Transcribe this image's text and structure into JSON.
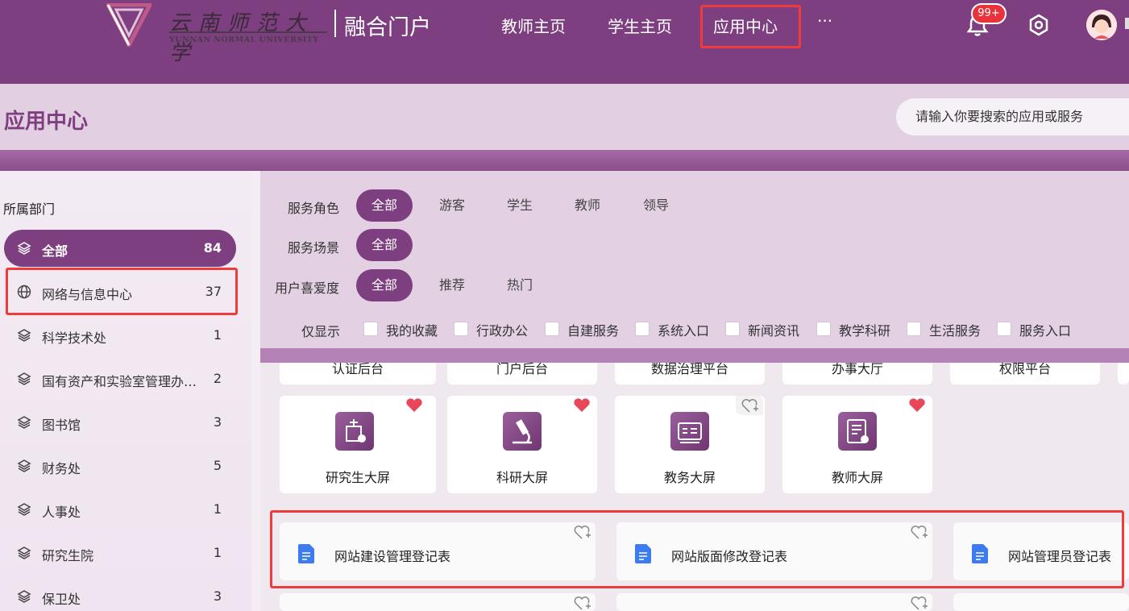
{
  "header": {
    "logo_cn": "云南师范大学",
    "logo_en": "YUNNAN NORMAL UNIVERSITY",
    "portal_title": "融合门户",
    "nav": [
      "教师主页",
      "学生主页",
      "应用中心"
    ],
    "more": "···",
    "badge": "99+",
    "colors": {
      "brand": "#7d3f80",
      "highlight": "#ee3b3b",
      "badge": "#e8323c"
    }
  },
  "page": {
    "title": "应用中心",
    "search_placeholder": "请输入你要搜索的应用或服务"
  },
  "sidebar": {
    "heading": "所属部门",
    "items": [
      {
        "label": "全部",
        "count": "84",
        "icon": "layers-icon"
      },
      {
        "label": "网络与信息中心",
        "count": "37",
        "icon": "globe-icon"
      },
      {
        "label": "科学技术处",
        "count": "1",
        "icon": "layers-icon"
      },
      {
        "label": "国有资产和实验室管理办公室",
        "count": "2",
        "icon": "layers-icon"
      },
      {
        "label": "图书馆",
        "count": "3",
        "icon": "layers-icon"
      },
      {
        "label": "财务处",
        "count": "5",
        "icon": "layers-icon"
      },
      {
        "label": "人事处",
        "count": "1",
        "icon": "layers-icon"
      },
      {
        "label": "研究生院",
        "count": "1",
        "icon": "layers-icon"
      },
      {
        "label": "保卫处",
        "count": "3",
        "icon": "layers-icon"
      }
    ]
  },
  "filters": {
    "role_label": "服务角色",
    "roles": [
      "全部",
      "游客",
      "学生",
      "教师",
      "领导"
    ],
    "scene_label": "服务场景",
    "scenes": [
      "全部"
    ],
    "pref_label": "用户喜爱度",
    "prefs": [
      "全部",
      "推荐",
      "热门"
    ],
    "only_label": "仅显示",
    "only_options": [
      "我的收藏",
      "行政办公",
      "自建服务",
      "系统入口",
      "新闻资讯",
      "教学科研",
      "生活服务",
      "服务入口"
    ]
  },
  "apps": {
    "cut_row": [
      "认证后台",
      "门户后台",
      "数据治理平台",
      "办事大厅",
      "权限平台"
    ],
    "row": [
      {
        "name": "研究生大屏",
        "favorited": true,
        "icon": "building-icon"
      },
      {
        "name": "科研大屏",
        "favorited": true,
        "icon": "microscope-icon"
      },
      {
        "name": "教务大屏",
        "favorited": false,
        "icon": "id-card-icon"
      },
      {
        "name": "教师大屏",
        "favorited": true,
        "icon": "document-clock-icon"
      }
    ],
    "forms": [
      "网站建设管理登记表",
      "网站版面修改登记表",
      "网站管理员登记表"
    ]
  }
}
